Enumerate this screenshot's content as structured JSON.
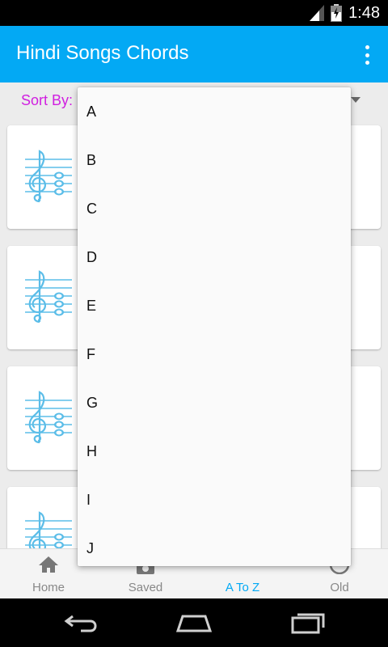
{
  "status_bar": {
    "time": "1:48"
  },
  "app_bar": {
    "title": "Hindi Songs Chords"
  },
  "sort": {
    "label": "Sort By:"
  },
  "dropdown": {
    "items": [
      "A",
      "B",
      "C",
      "D",
      "E",
      "F",
      "G",
      "H",
      "I",
      "J"
    ]
  },
  "bottom_nav": {
    "items": [
      {
        "label": "Home",
        "icon": "home-icon"
      },
      {
        "label": "Saved",
        "icon": "saved-icon"
      },
      {
        "label": "A To Z",
        "icon": "a-to-z-icon"
      },
      {
        "label": "Old",
        "icon": "clock-icon"
      }
    ],
    "active": "A To Z"
  },
  "colors": {
    "primary": "#03a9f4",
    "sort_label": "#d01fe0",
    "music_icon": "#5bbde8"
  }
}
